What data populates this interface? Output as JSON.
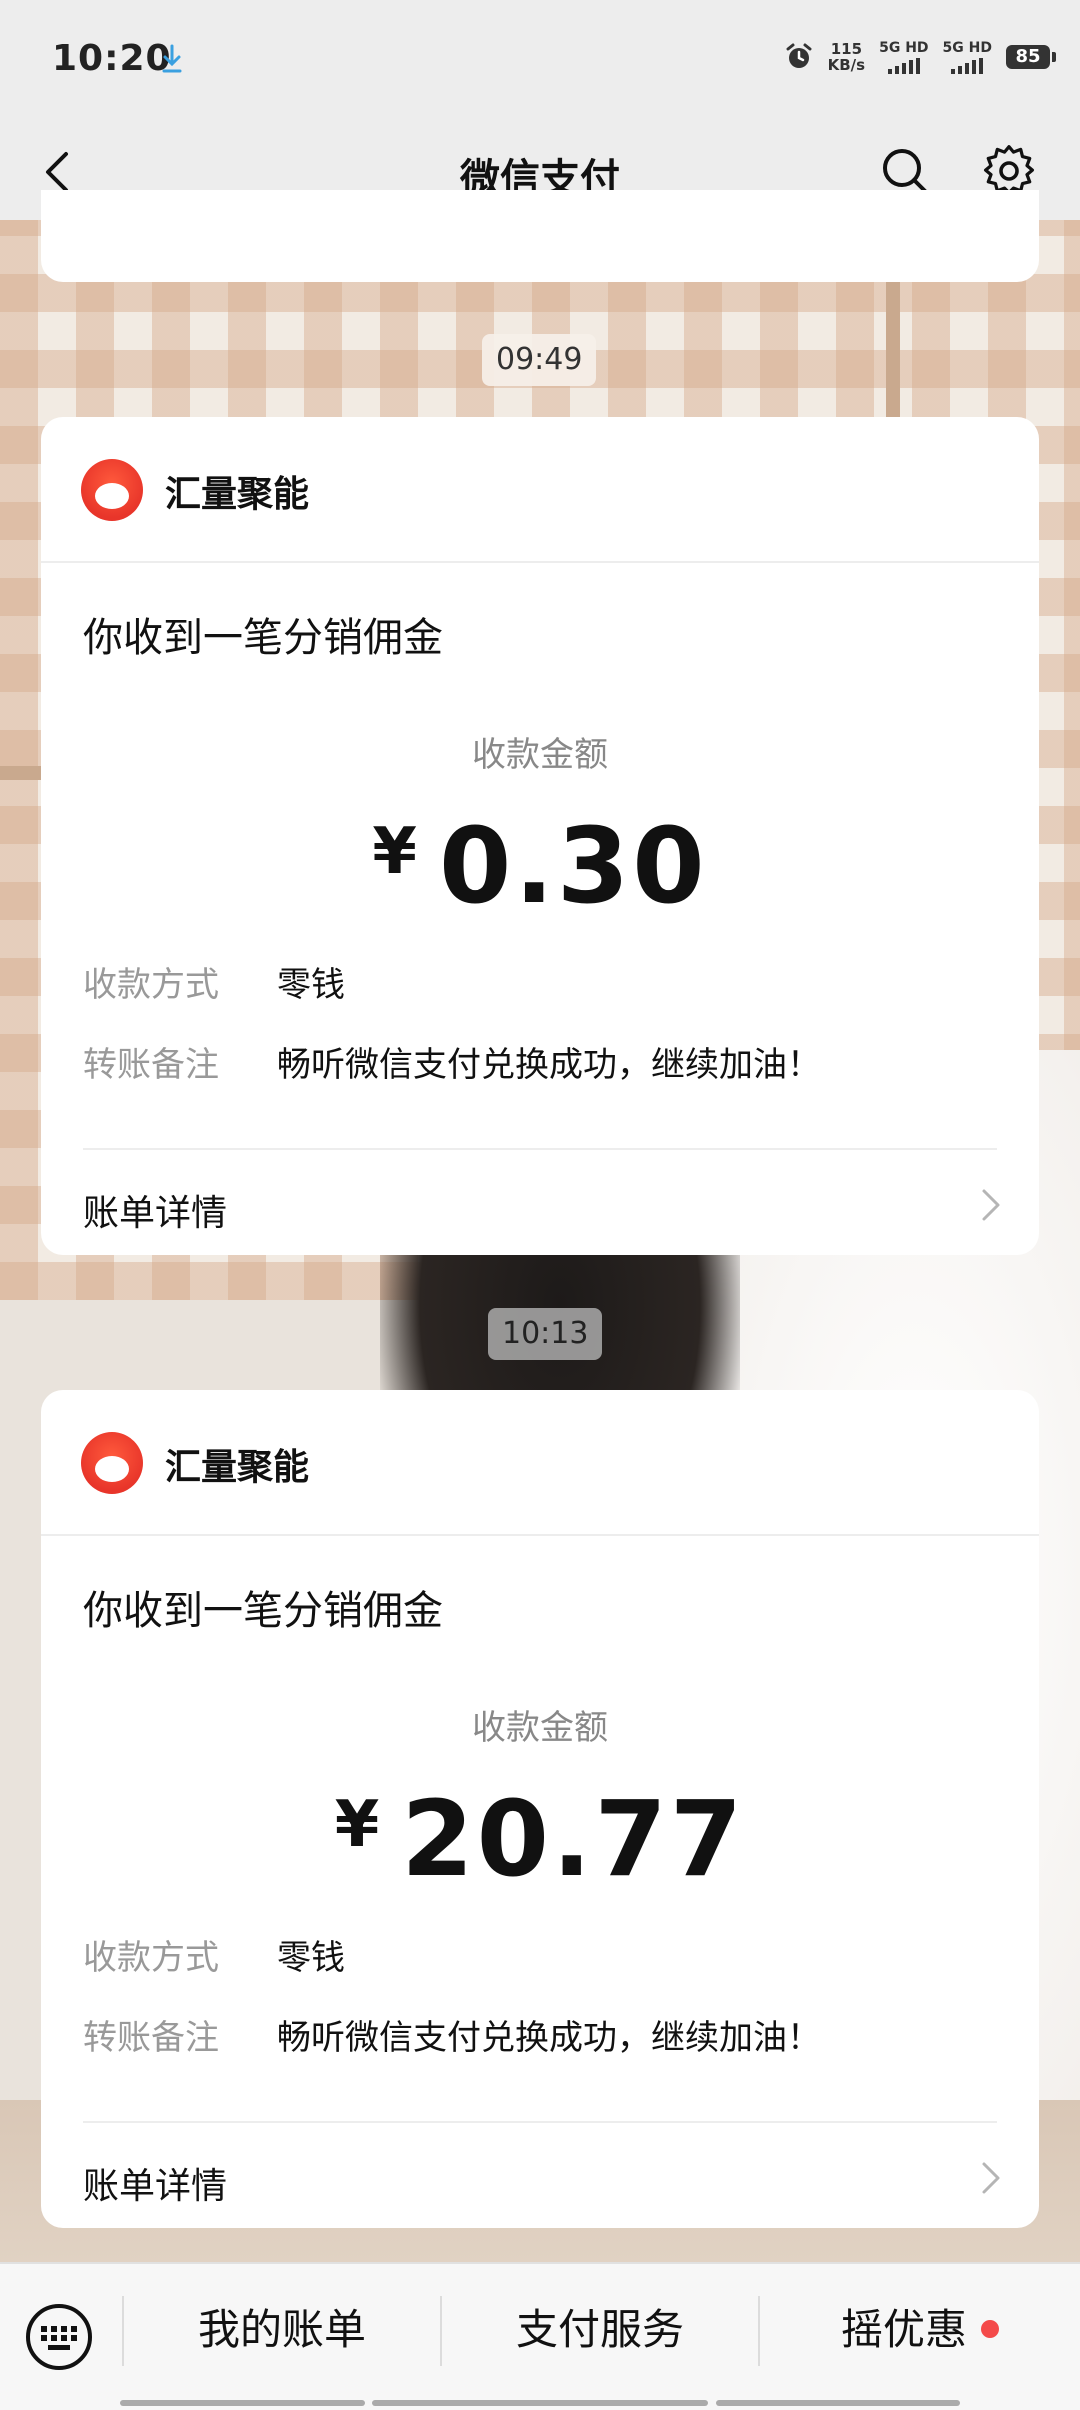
{
  "status_bar": {
    "time": "10:20",
    "net_speed_value": "115",
    "net_speed_unit": "KB/s",
    "sim1_label": "5G HD",
    "sim2_label": "5G HD",
    "battery": "85",
    "icons": [
      "download-icon",
      "alarm-icon",
      "signal-icon",
      "battery-icon"
    ]
  },
  "nav": {
    "title": "微信支付",
    "icons": [
      "back-arrow-icon",
      "search-icon",
      "gear-icon"
    ]
  },
  "messages": [
    {
      "time": "09:49",
      "merchant": "汇量聚能",
      "title": "你收到一笔分销佣金",
      "amount_label": "收款金额",
      "currency": "¥",
      "amount": "0.30",
      "method_label": "收款方式",
      "method": "零钱",
      "note_label": "转账备注",
      "note": "畅听微信支付兑换成功，继续加油！",
      "detail_label": "账单详情"
    },
    {
      "time": "10:13",
      "merchant": "汇量聚能",
      "title": "你收到一笔分销佣金",
      "amount_label": "收款金额",
      "currency": "¥",
      "amount": "20.77",
      "method_label": "收款方式",
      "method": "零钱",
      "note_label": "转账备注",
      "note": "畅听微信支付兑换成功，继续加油！",
      "detail_label": "账单详情"
    }
  ],
  "bottom_menu": {
    "items": [
      "我的账单",
      "支付服务",
      "摇优惠"
    ],
    "icons": [
      "keyboard-icon"
    ],
    "accent_dot_color": "#f44a4a"
  }
}
